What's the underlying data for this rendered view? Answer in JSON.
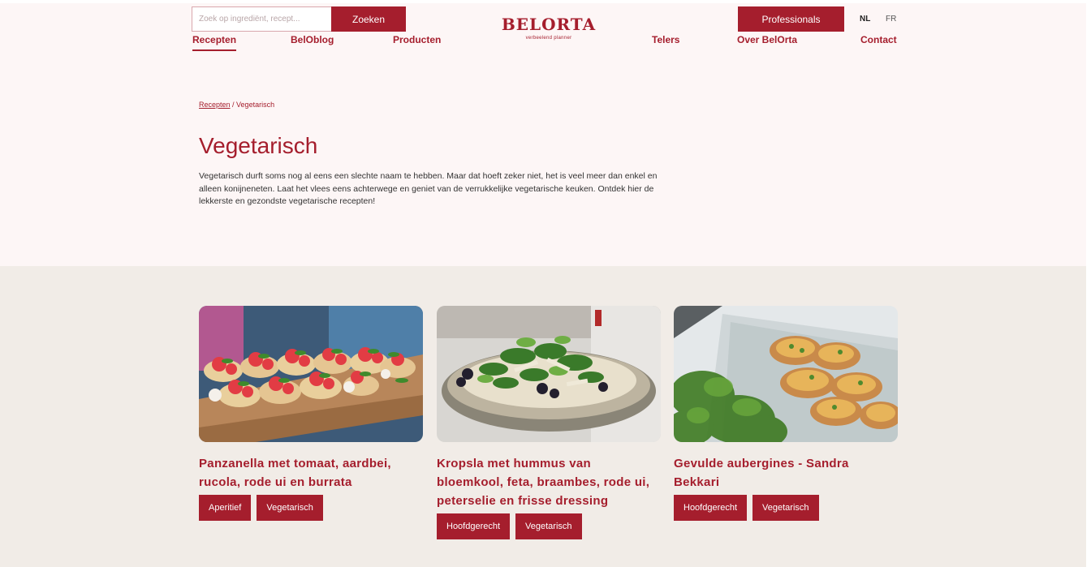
{
  "header": {
    "search_placeholder": "Zoek op ingrediënt, recept...",
    "search_button": "Zoeken",
    "logo_name": "BELORTA",
    "logo_tagline": "verbeelend planner",
    "professionals_button": "Professionals",
    "lang_nl": "NL",
    "lang_fr": "FR"
  },
  "nav": {
    "items": [
      {
        "label": "Recepten"
      },
      {
        "label": "BelOblog"
      },
      {
        "label": "Producten"
      },
      {
        "label": "Telers"
      },
      {
        "label": "Over BelOrta"
      },
      {
        "label": "Contact"
      }
    ]
  },
  "breadcrumb": {
    "parent": "Recepten",
    "separator": " / ",
    "current": "Vegetarisch"
  },
  "page": {
    "title": "Vegetarisch",
    "intro": "Vegetarisch durft soms nog al eens een slechte naam te hebben. Maar dat hoeft zeker niet, het is veel meer dan enkel en alleen konijneneten. Laat het vlees eens achterwege en geniet van de verrukkelijke vegetarische keuken. Ontdek hier de lekkerste en gezondste vegetarische recepten!"
  },
  "recipes": [
    {
      "title": "Panzanella met tomaat, aardbei, rucola, rode ui en burrata",
      "tags": [
        "Aperitief",
        "Vegetarisch"
      ]
    },
    {
      "title": "Kropsla met hummus van bloemkool, feta, braambes, rode ui, peterselie en frisse dressing",
      "tags": [
        "Hoofdgerecht",
        "Vegetarisch"
      ]
    },
    {
      "title": "Gevulde aubergines - Sandra Bekkari",
      "tags": [
        "Hoofdgerecht",
        "Vegetarisch"
      ]
    }
  ],
  "colors": {
    "brand": "#a51e2d",
    "page_bg": "#fdf6f6",
    "grid_bg": "#f1ece7"
  }
}
